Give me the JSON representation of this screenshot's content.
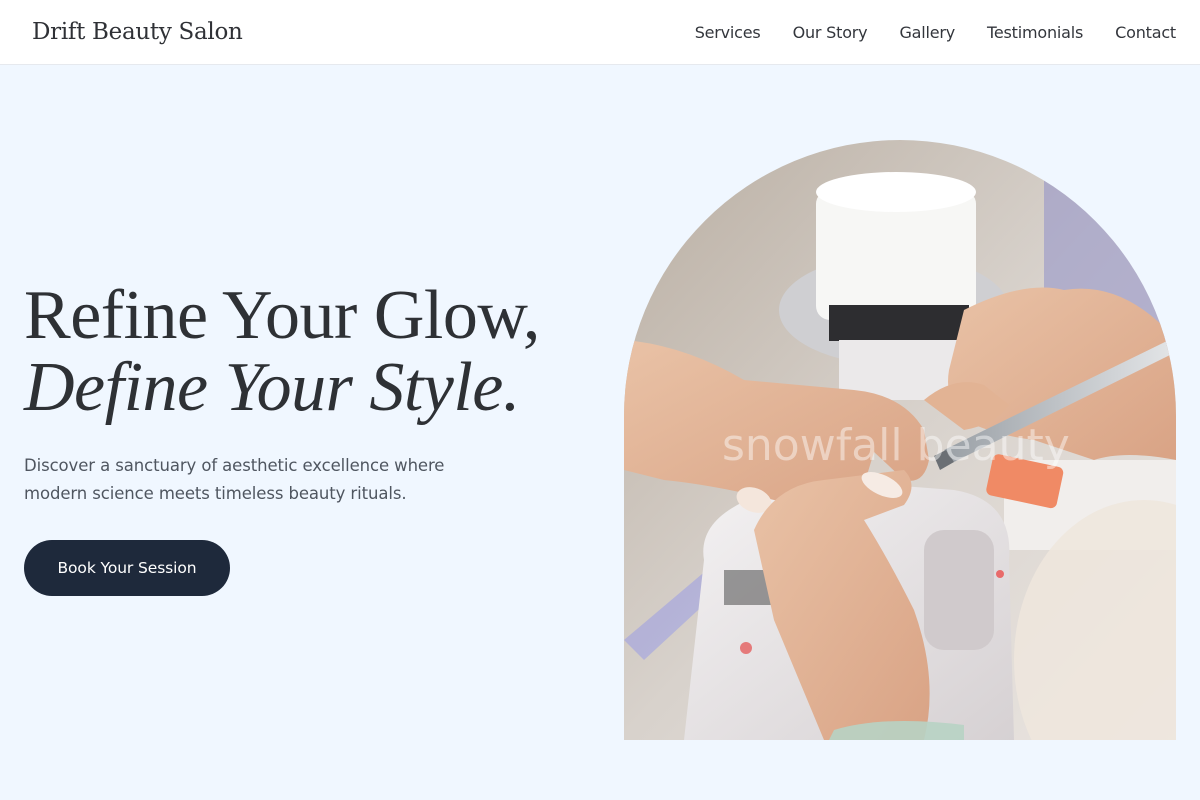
{
  "brand": {
    "name": "Drift Beauty Salon"
  },
  "nav": {
    "items": [
      {
        "label": "Services"
      },
      {
        "label": "Our Story"
      },
      {
        "label": "Gallery"
      },
      {
        "label": "Testimonials"
      },
      {
        "label": "Contact"
      }
    ]
  },
  "hero": {
    "headline_line1": "Refine Your Glow,",
    "headline_line2": "Define Your Style.",
    "subtitle": "Discover a sanctuary of aesthetic excellence where modern science meets timeless beauty rituals.",
    "cta_label": "Book Your Session",
    "image_watermark": "snowfall beauty"
  },
  "colors": {
    "background": "#f0f7ff",
    "nav_background": "#ffffff",
    "button": "#1e293b",
    "text": "#2e3135"
  }
}
